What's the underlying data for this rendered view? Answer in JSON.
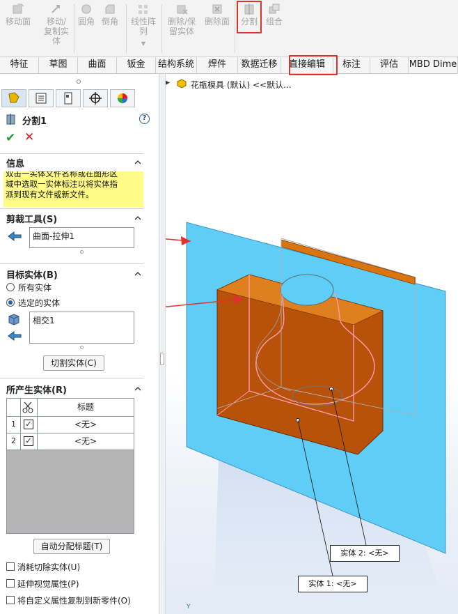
{
  "ribbon": {
    "move_face": "移动面",
    "move_copy_body": [
      "移动/",
      "复制实",
      "体"
    ],
    "fillet": "圆角",
    "chamfer": "倒角",
    "linear_pattern": [
      "线性阵",
      "列"
    ],
    "delete_keep_body": [
      "删除/保",
      "留实体"
    ],
    "delete_face": "删除面",
    "split": "分割",
    "combine": "组合",
    "highlight_color": "#e0312b"
  },
  "tabs": [
    "特征",
    "草图",
    "曲面",
    "钣金",
    "结构系统",
    "焊件",
    "数据迁移",
    "直接编辑",
    "标注",
    "评估",
    "MBD Dime"
  ],
  "tree": {
    "item": "花瓶模具 (默认) <<默认..."
  },
  "panel": {
    "title": "分割1",
    "info": {
      "header": "信息",
      "text": [
        "双击一实体文件名称或在图形区",
        "域中选取一实体标注以将实体指",
        "派到现有文件或新文件。"
      ]
    },
    "trim_tools": {
      "header": "剪裁工具(S)",
      "value": "曲面-拉伸1"
    },
    "target_bodies": {
      "header": "目标实体(B)",
      "all_bodies": "所有实体",
      "selected_bodies": "选定的实体",
      "value": "相交1",
      "cut_button": "切割实体(C)"
    },
    "resulting_bodies": {
      "header": "所产生实体(R)",
      "column_title": "标题",
      "rows": [
        {
          "num": "1",
          "checked": true,
          "title": "<无>"
        },
        {
          "num": "2",
          "checked": true,
          "title": "<无>"
        }
      ]
    },
    "auto_assign": "自动分配标题(T)",
    "options": [
      {
        "label": "消耗切除实体(U)",
        "checked": false
      },
      {
        "label": "延伸视觉属性(P)",
        "checked": false
      },
      {
        "label": "将自定义属性复制到新零件(O)",
        "checked": false
      }
    ]
  },
  "viewport": {
    "callouts": [
      "实体  2: <无>",
      "实体  1: <无>"
    ],
    "triad_label": "Y",
    "surface_color": "#5fcdf5",
    "body_color": "#c75a06"
  }
}
